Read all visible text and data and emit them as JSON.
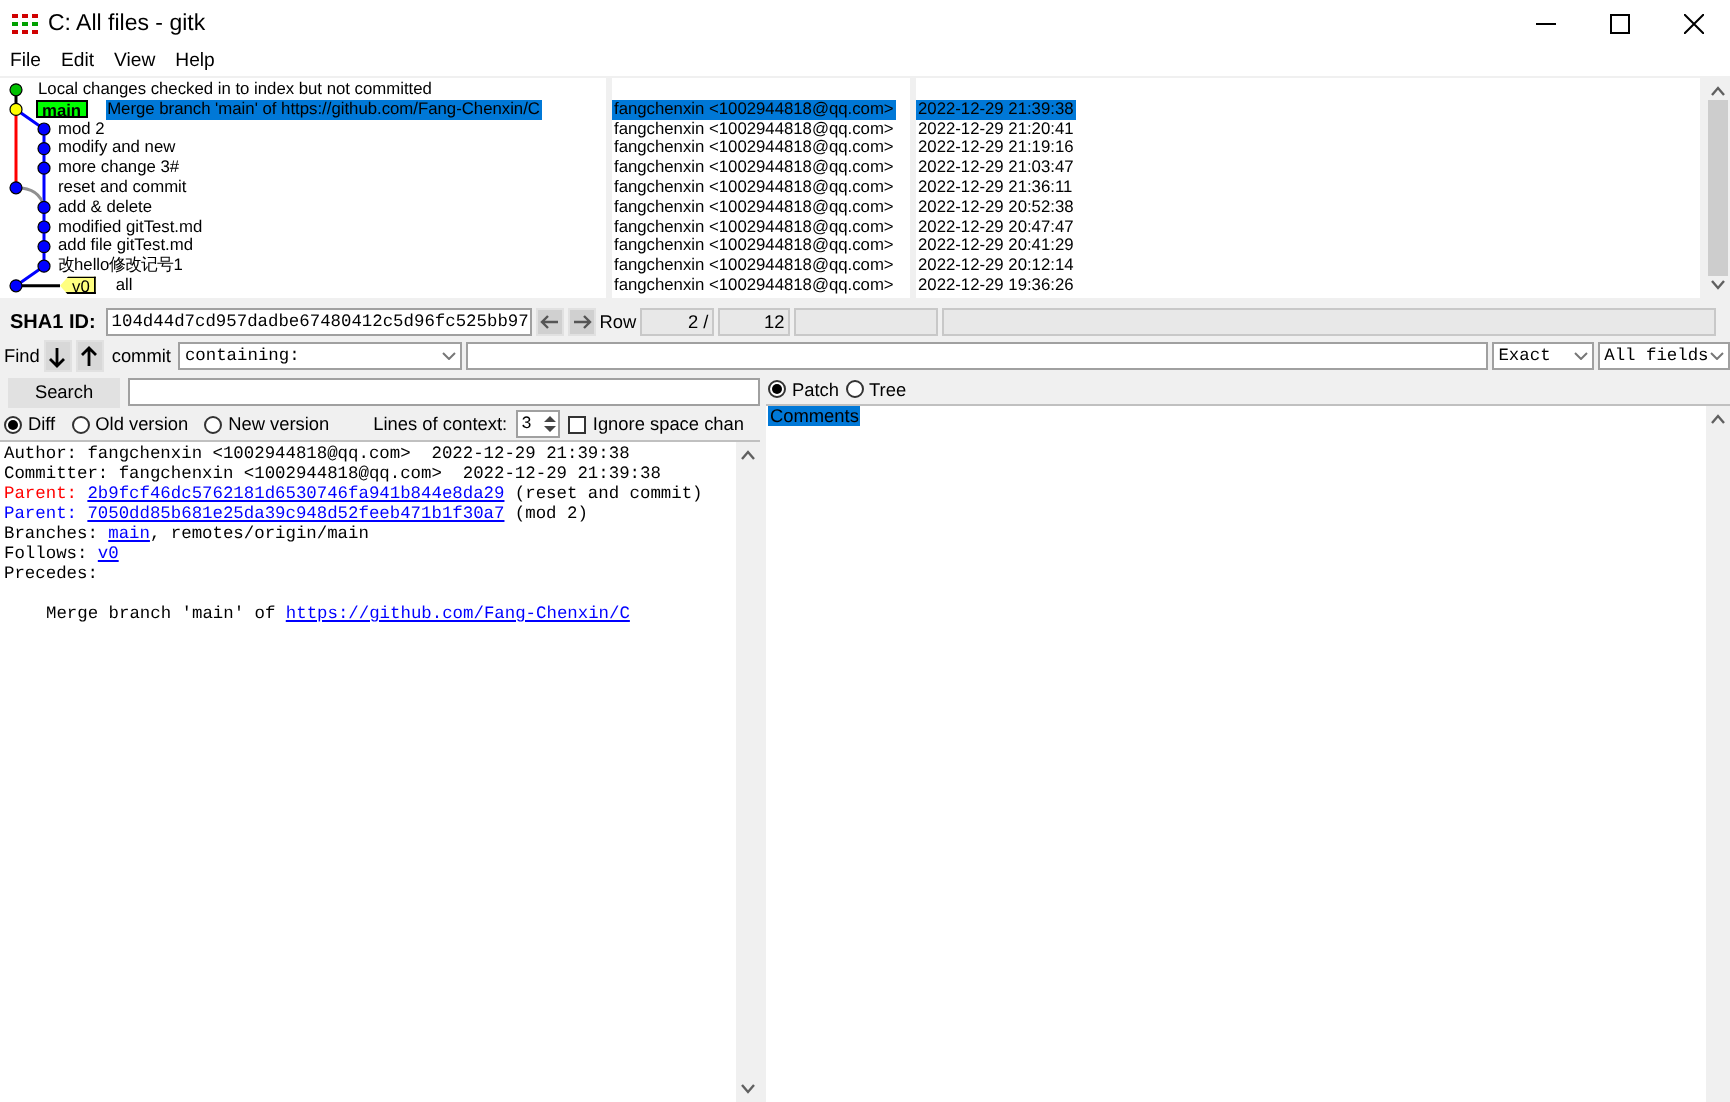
{
  "window": {
    "title": "C: All files - gitk"
  },
  "menu": [
    "File",
    "Edit",
    "View",
    "Help"
  ],
  "commits": [
    {
      "subject": "Local changes checked in to index but not committed",
      "selected": false,
      "color": "#00c000"
    },
    {
      "subject": "Merge branch 'main' of https://github.com/Fang-Chenxin/C",
      "author": "fangchenxin <1002944818@qq.com>",
      "date": "2022-12-29 21:39:38",
      "refs": [
        {
          "label": "main",
          "kind": "head"
        }
      ],
      "selected": true,
      "color": "#ffff00"
    },
    {
      "subject": "mod 2",
      "author": "fangchenxin <1002944818@qq.com>",
      "date": "2022-12-29 21:20:41",
      "selected": false,
      "color": "#0000ff"
    },
    {
      "subject": "modify and new",
      "author": "fangchenxin <1002944818@qq.com>",
      "date": "2022-12-29 21:19:16",
      "selected": false,
      "color": "#0000ff"
    },
    {
      "subject": "more change 3#",
      "author": "fangchenxin <1002944818@qq.com>",
      "date": "2022-12-29 21:03:47",
      "selected": false,
      "color": "#0000ff"
    },
    {
      "subject": "reset and commit",
      "author": "fangchenxin <1002944818@qq.com>",
      "date": "2022-12-29 21:36:11",
      "selected": false,
      "color": "#0000ff"
    },
    {
      "subject": "add & delete",
      "author": "fangchenxin <1002944818@qq.com>",
      "date": "2022-12-29 20:52:38",
      "selected": false,
      "color": "#0000ff"
    },
    {
      "subject": "modified gitTest.md",
      "author": "fangchenxin <1002944818@qq.com>",
      "date": "2022-12-29 20:47:47",
      "selected": false,
      "color": "#0000ff"
    },
    {
      "subject": "add file gitTest.md",
      "author": "fangchenxin <1002944818@qq.com>",
      "date": "2022-12-29 20:41:29",
      "selected": false,
      "color": "#0000ff"
    },
    {
      "subject": "改hello修改记号1",
      "author": "fangchenxin <1002944818@qq.com>",
      "date": "2022-12-29 20:12:14",
      "selected": false,
      "color": "#0000ff"
    },
    {
      "subject": "all",
      "author": "fangchenxin <1002944818@qq.com>",
      "date": "2022-12-29 19:36:26",
      "refs": [
        {
          "label": "v0",
          "kind": "tag"
        }
      ],
      "selected": false,
      "color": "#0000ff"
    }
  ],
  "sha1": {
    "label": "SHA1 ID:",
    "value": "104d44d7cd957dadbe67480412c5d96fc525bb97"
  },
  "row": {
    "label": "Row",
    "current": "2 /",
    "total": "12"
  },
  "find": {
    "label": "Find",
    "type": "commit",
    "mode": "containing:",
    "match": "Exact",
    "fields": "All fields"
  },
  "search": {
    "button": "Search"
  },
  "view": [
    {
      "label": "Patch",
      "selected": true
    },
    {
      "label": "Tree",
      "selected": false
    }
  ],
  "diff_modes": [
    {
      "label": "Diff",
      "selected": true
    },
    {
      "label": "Old version",
      "selected": false
    },
    {
      "label": "New version",
      "selected": false
    }
  ],
  "context": {
    "label": "Lines of context:",
    "value": "3"
  },
  "ignore_space": {
    "label": "Ignore space chan",
    "checked": false
  },
  "details": [
    {
      "label": "Author:",
      "text": "fangchenxin <1002944818@qq.com>  2022-12-29 21:39:38"
    },
    {
      "label": "Committer:",
      "text": "fangchenxin <1002944818@qq.com>  2022-12-29 21:39:38"
    },
    {
      "label": "Parent:",
      "link": "2b9fcf46dc5762181d6530746fa941b844e8da29",
      "text": "(reset and commit)",
      "color": "#ff0000"
    },
    {
      "label": "Parent:",
      "link": "7050dd85b681e25da39c948d52feeb471b1f30a7",
      "text": "(mod 2)",
      "color": "#0000ff"
    },
    {
      "label": "Branches:",
      "link": "main",
      "text": ", remotes/origin/main"
    },
    {
      "label": "Follows:",
      "link": "v0"
    },
    {
      "label": "Precedes:"
    }
  ],
  "message": {
    "text": "Merge branch 'main' of",
    "link": "https://github.com/Fang-Chenxin/C"
  },
  "files": [
    {
      "label": "Comments",
      "selected": true
    }
  ]
}
